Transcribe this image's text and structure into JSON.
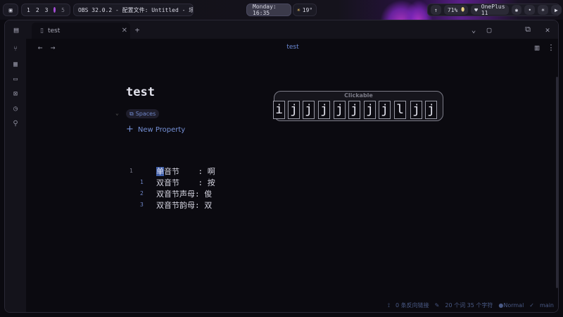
{
  "taskbar": {
    "workspaces": [
      "1",
      "2",
      "3",
      "5"
    ],
    "window_title": "OBS 32.0.2 - 配置文件: Untitled - 场景: Un…",
    "clock": "Monday: 16:35",
    "weather": "19°",
    "weather_icon": "sun-icon",
    "chips": [
      "↑",
      "71%",
      "OnePlus 11",
      "✱",
      "•",
      "☀",
      "▶"
    ]
  },
  "window": {
    "tab_label": "test",
    "tab_close": "✕",
    "new_tab": "+",
    "header_title": "test",
    "controls": [
      "⌄",
      "▢",
      "⧉",
      "✕"
    ]
  },
  "note": {
    "title": "test",
    "tag": "Spaces",
    "new_property": "New Property",
    "lines": [
      {
        "num": "1",
        "first": "单",
        "rest": "音节    : 啊"
      },
      {
        "num": "1",
        "text": "双音节    : 按"
      },
      {
        "num": "2",
        "text": "双音节声母: 俊"
      },
      {
        "num": "3",
        "text": "双音节韵母: 双"
      }
    ]
  },
  "clickable": {
    "label": "Clickable",
    "hints": [
      "i",
      "j",
      "j",
      "j",
      "j",
      "j",
      "j",
      "j",
      "l",
      "j",
      "j"
    ]
  },
  "status": {
    "backlinks": "0 条反向链接",
    "counts": "20 个词  35 个字符",
    "mode": "Normal",
    "branch": "main"
  }
}
